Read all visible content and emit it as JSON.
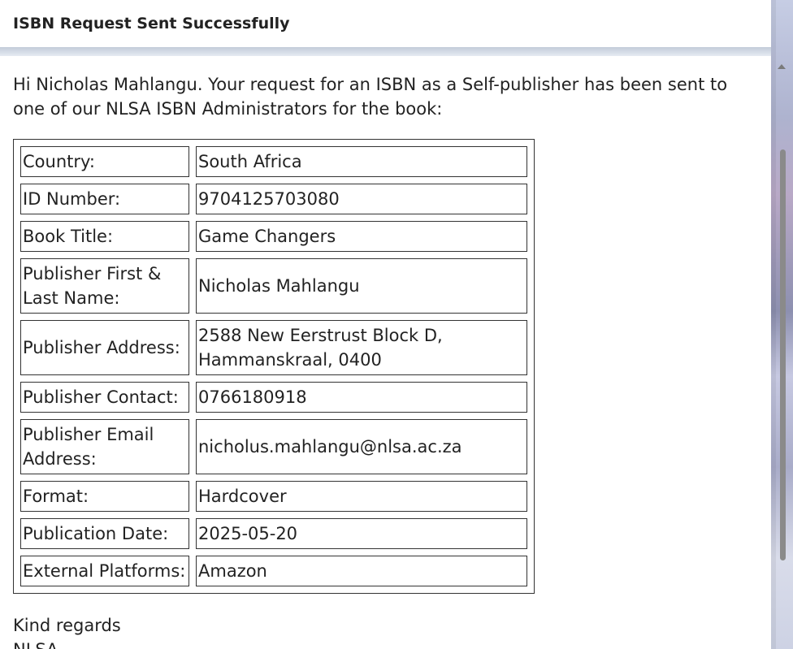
{
  "window": {
    "title": "ISBN Request Sent Successfully"
  },
  "message": {
    "intro": "Hi Nicholas Mahlangu. Your request for an ISBN as a Self-publisher has been sent to one of our NLSA ISBN Administrators for the book:",
    "details": [
      {
        "label": "Country:",
        "value": "South Africa"
      },
      {
        "label": "ID Number:",
        "value": "9704125703080"
      },
      {
        "label": "Book Title:",
        "value": "Game Changers"
      },
      {
        "label": "Publisher First & Last Name:",
        "value": "Nicholas Mahlangu"
      },
      {
        "label": "Publisher Address:",
        "value": "2588 New Eerstrust Block D, Hammanskraal, 0400"
      },
      {
        "label": "Publisher Contact:",
        "value": "0766180918"
      },
      {
        "label": "Publisher Email Address:",
        "value": "nicholus.mahlangu@nlsa.ac.za"
      },
      {
        "label": "Format:",
        "value": "Hardcover"
      },
      {
        "label": "Publication Date:",
        "value": "2025-05-20"
      },
      {
        "label": "External Platforms:",
        "value": "Amazon"
      }
    ],
    "closing_line1": "Kind regards",
    "closing_line2": "NLSA"
  },
  "icons": {
    "scroll_up": "scroll-up-arrow-icon"
  }
}
